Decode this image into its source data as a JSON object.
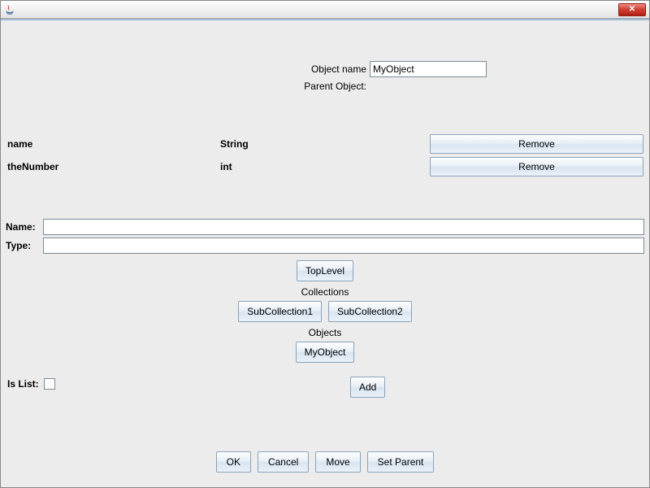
{
  "titlebar": {
    "close_symbol": "✕"
  },
  "header": {
    "object_name_label": "Object name",
    "object_name_value": "MyObject",
    "parent_object_label": "Parent Object:"
  },
  "fields": [
    {
      "name": "name",
      "type": "String",
      "remove_label": "Remove"
    },
    {
      "name": "theNumber",
      "type": "int",
      "remove_label": "Remove"
    }
  ],
  "form": {
    "name_label": "Name:",
    "name_value": "",
    "type_label": "Type:",
    "type_value": ""
  },
  "buttons": {
    "toplevel": "TopLevel",
    "collections_label": "Collections",
    "subcollection1": "SubCollection1",
    "subcollection2": "SubCollection2",
    "objects_label": "Objects",
    "myobject": "MyObject",
    "add": "Add"
  },
  "islist": {
    "label": "Is List:",
    "checked": false
  },
  "footer": {
    "ok": "OK",
    "cancel": "Cancel",
    "move": "Move",
    "set_parent": "Set Parent"
  }
}
